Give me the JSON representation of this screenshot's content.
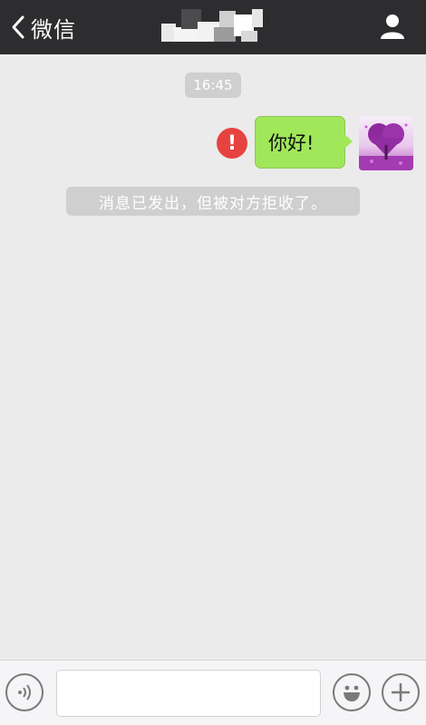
{
  "navbar": {
    "back_label": "微信",
    "back_icon": "chevron-left-icon",
    "profile_icon": "person-icon",
    "background": "#2d2d2f"
  },
  "chat": {
    "timestamp": "16:45",
    "messages": [
      {
        "sender": "self",
        "text": "你好!",
        "status_icon": "error-exclamation-icon",
        "status_mark": "!"
      }
    ],
    "system_notice": "消息已发出，但被对方拒收了。",
    "bubble_color": "#a0e75a",
    "error_color": "#e64340"
  },
  "input_bar": {
    "voice_icon": "voice-icon",
    "emoji_icon": "emoji-icon",
    "plus_icon": "plus-icon",
    "text_value": ""
  }
}
